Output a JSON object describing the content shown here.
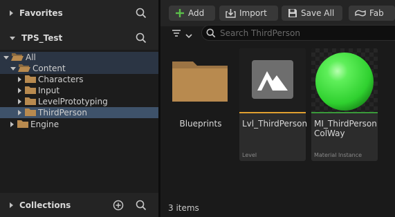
{
  "sources": {
    "favorites_label": "Favorites",
    "project_label": "TPS_Test",
    "collections_label": "Collections",
    "tree": [
      {
        "label": "All"
      },
      {
        "label": "Content"
      },
      {
        "label": "Characters"
      },
      {
        "label": "Input"
      },
      {
        "label": "LevelPrototyping"
      },
      {
        "label": "ThirdPerson"
      },
      {
        "label": "Engine"
      }
    ]
  },
  "toolbar": {
    "add_label": "Add",
    "import_label": "Import",
    "save_all_label": "Save All",
    "fab_label": "Fab"
  },
  "search": {
    "placeholder": "Search ThirdPerson"
  },
  "assets": [
    {
      "name": "Blueprints",
      "type": ""
    },
    {
      "name": "Lvl_ThirdPerson",
      "type": "Level",
      "type_color": "#e0a030"
    },
    {
      "name": "MI_ThirdPerson ColWay",
      "type": "Material Instance",
      "type_color": "#3a9a3a"
    }
  ],
  "status": {
    "item_count": "3 items"
  },
  "colors": {
    "accent_add": "#5bbf4a",
    "selection": "#3e526a",
    "folder": "#b88a4f"
  }
}
